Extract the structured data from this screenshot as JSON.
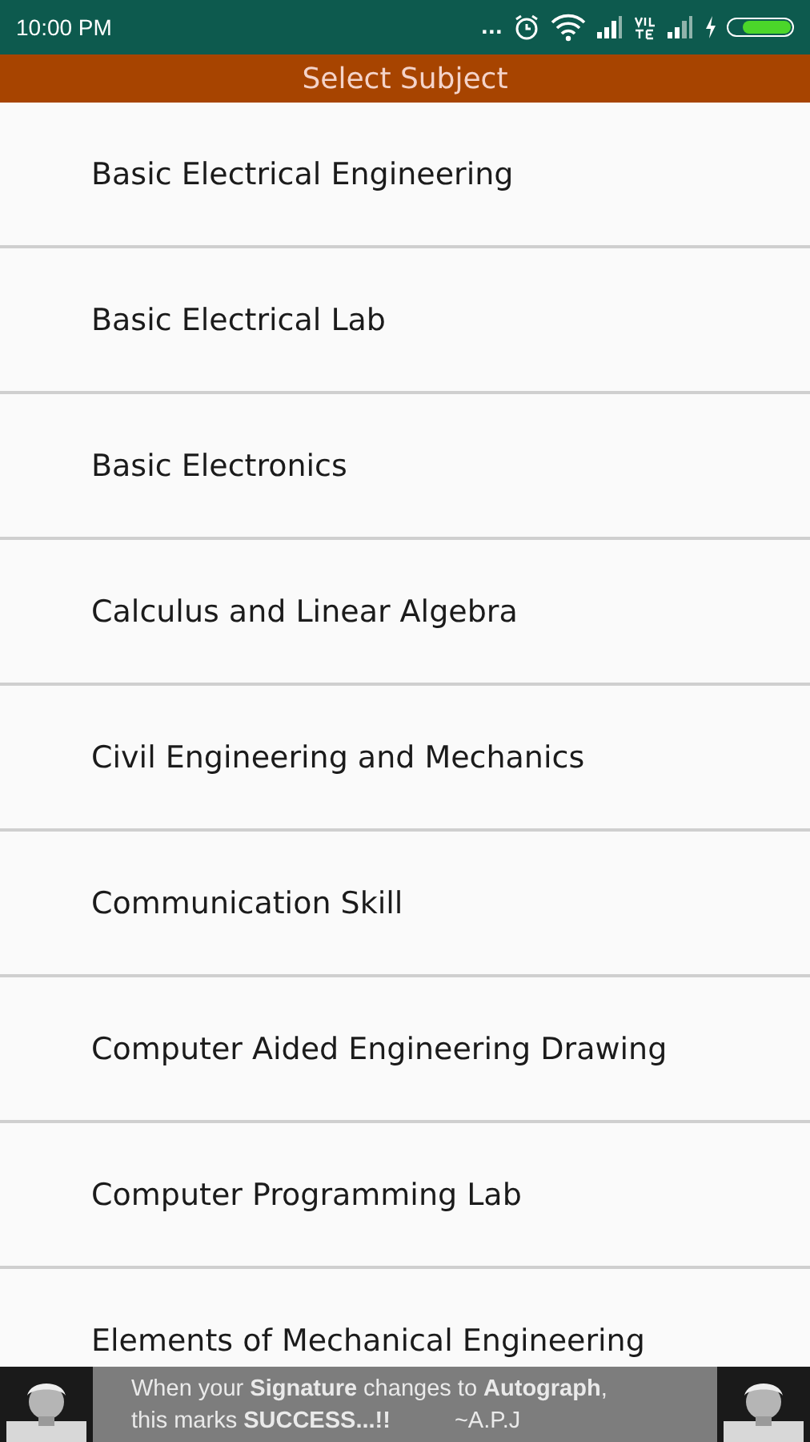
{
  "status_bar": {
    "time": "10:00 PM",
    "more": "..."
  },
  "header": {
    "title": "Select Subject"
  },
  "subjects": [
    {
      "name": "Basic Electrical Engineering"
    },
    {
      "name": "Basic Electrical Lab"
    },
    {
      "name": "Basic Electronics"
    },
    {
      "name": "Calculus and Linear Algebra"
    },
    {
      "name": "Civil Engineering and Mechanics"
    },
    {
      "name": "Communication Skill"
    },
    {
      "name": "Computer Aided Engineering Drawing"
    },
    {
      "name": "Computer Programming Lab"
    },
    {
      "name": "Elements of Mechanical Engineering"
    }
  ],
  "banner": {
    "line_1": "When your **Signature**  changes to **Autograph**,",
    "line_2": "this marks **SUCCESS...!!**",
    "signature": "~A.P.J"
  }
}
